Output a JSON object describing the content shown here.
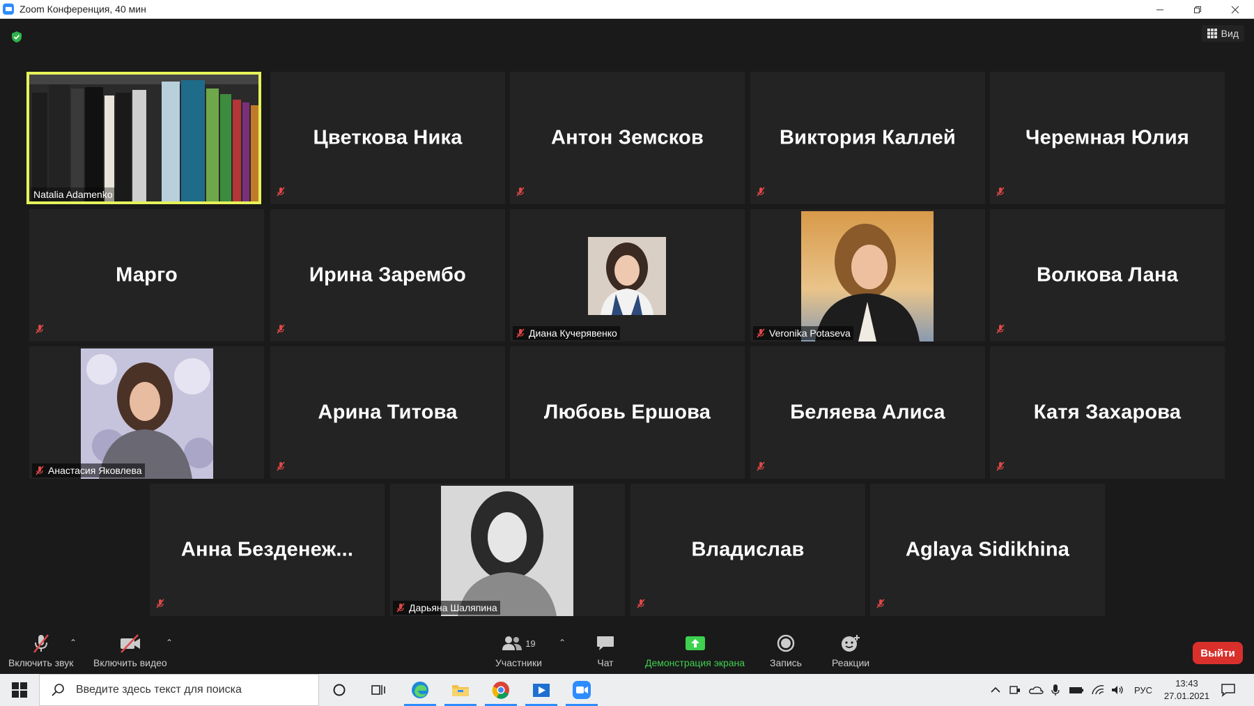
{
  "window": {
    "title": "Zoom Конференция, 40 мин",
    "controls": [
      "minimize",
      "restore",
      "close"
    ]
  },
  "top_bar": {
    "view_label": "Вид"
  },
  "participants": [
    {
      "name": "Natalia Adamenko",
      "display": "video",
      "active_speaker": true
    },
    {
      "name": "Цветкова Ника",
      "display": "name",
      "muted": true
    },
    {
      "name": "Антон Земсков",
      "display": "name",
      "muted": true
    },
    {
      "name": "Виктория Каллей",
      "display": "name",
      "muted": true
    },
    {
      "name": "Черемная Юлия",
      "display": "name",
      "muted": true
    },
    {
      "name": "Марго",
      "display": "name",
      "muted": true
    },
    {
      "name": "Ирина Зарембо",
      "display": "name",
      "muted": true
    },
    {
      "name": "Диана Кучерявенко",
      "display": "photo",
      "muted": true
    },
    {
      "name": "Veronika Potaseva",
      "display": "photo",
      "muted": true
    },
    {
      "name": "Волкова Лана",
      "display": "name",
      "muted": true
    },
    {
      "name": "Анастасия Яковлева",
      "display": "photo",
      "muted": true
    },
    {
      "name": "Арина Титова",
      "display": "name",
      "muted": true
    },
    {
      "name": "Любовь Ершова",
      "display": "name",
      "muted": true
    },
    {
      "name": "Беляева Алиса",
      "display": "name",
      "muted": true
    },
    {
      "name": "Катя Захарова",
      "display": "name",
      "muted": true
    },
    {
      "name": "Анна  Безденеж...",
      "display": "name",
      "muted": true
    },
    {
      "name": "Дарьяна Шаляпина",
      "display": "photo",
      "muted": true
    },
    {
      "name": "Владислав",
      "display": "name",
      "muted": true
    },
    {
      "name": "Aglaya Sidikhina",
      "display": "name",
      "muted": true
    }
  ],
  "toolbar": {
    "unmute_label": "Включить звук",
    "start_video_label": "Включить видео",
    "participants_label": "Участники",
    "participants_count": "19",
    "chat_label": "Чат",
    "share_screen_label": "Демонстрация экрана",
    "record_label": "Запись",
    "reactions_label": "Реакции",
    "leave_label": "Выйти"
  },
  "taskbar": {
    "search_placeholder": "Введите здесь текст для поиска",
    "language": "РУС",
    "time": "13:43",
    "date": "27.01.2021",
    "apps": [
      "cortana",
      "task-view",
      "edge",
      "file-explorer",
      "chrome",
      "media-player",
      "zoom"
    ]
  },
  "colors": {
    "active_speaker_border": "#e5f25a",
    "leave_button": "#d9302c",
    "share_green": "#3ed04f",
    "muted_red": "#e04848",
    "tile_bg": "#232323",
    "meeting_bg": "#1a1a1a"
  }
}
